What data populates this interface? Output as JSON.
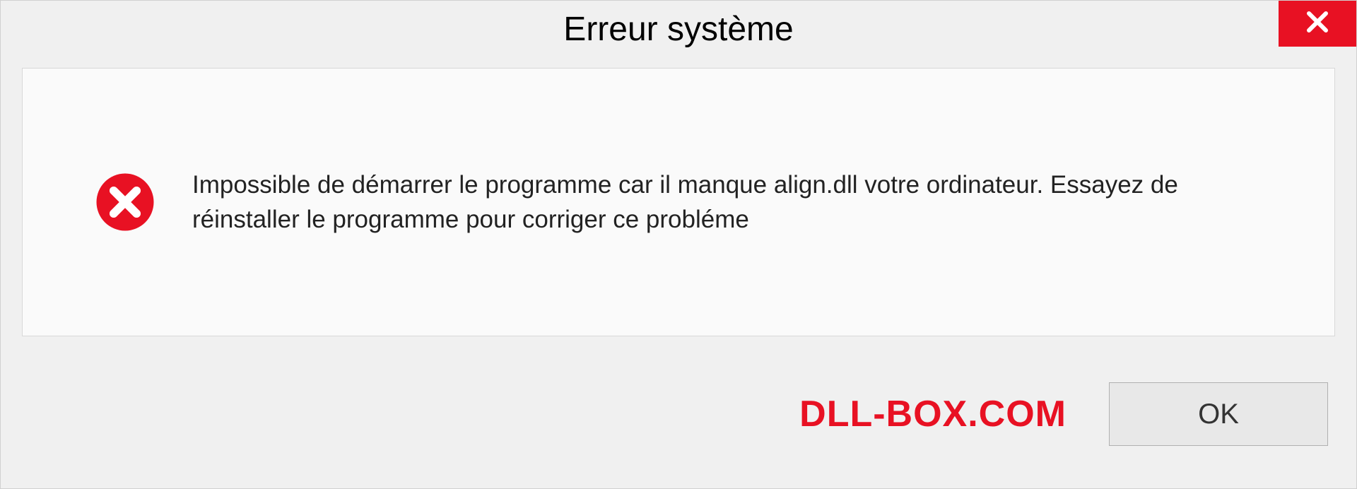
{
  "dialog": {
    "title": "Erreur système",
    "message": "Impossible de démarrer le programme car il manque align.dll votre ordinateur. Essayez de réinstaller le programme pour corriger ce probléme",
    "ok_label": "OK",
    "watermark": "DLL-BOX.COM"
  },
  "colors": {
    "close_bg": "#e81123",
    "error_red": "#e81123",
    "watermark_red": "#e81123"
  }
}
